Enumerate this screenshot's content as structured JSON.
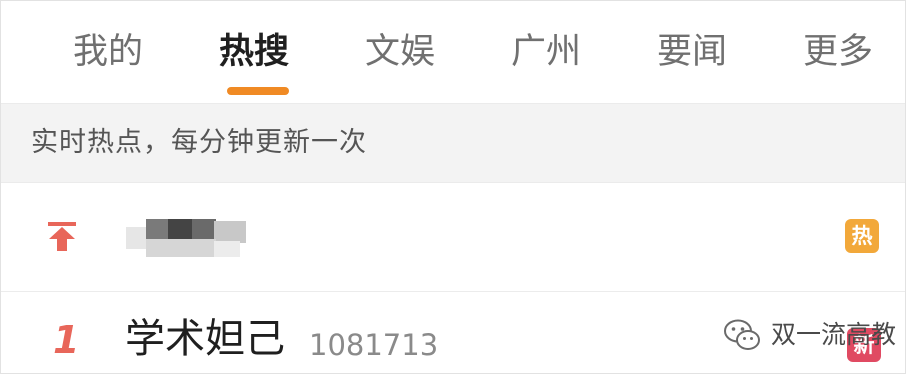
{
  "tabs": [
    {
      "label": "我的"
    },
    {
      "label": "热搜"
    },
    {
      "label": "文娱"
    },
    {
      "label": "广州"
    },
    {
      "label": "要闻"
    },
    {
      "label": "更多"
    }
  ],
  "active_tab": "热搜",
  "info_strip": "实时热点，每分钟更新一次",
  "pinned_row": {
    "icon": "pin-top-icon",
    "title_obscured": true,
    "badge": "热"
  },
  "rows": [
    {
      "rank": "1",
      "title": "学术妲己",
      "count": "1081713",
      "badge": "新"
    }
  ],
  "watermark": {
    "icon": "wechat-icon",
    "text": "双一流高教"
  },
  "colors": {
    "accent": "#f08a24",
    "hot_badge": "#f2a83a",
    "new_badge": "#e04a62",
    "rank": "#e8665a"
  }
}
